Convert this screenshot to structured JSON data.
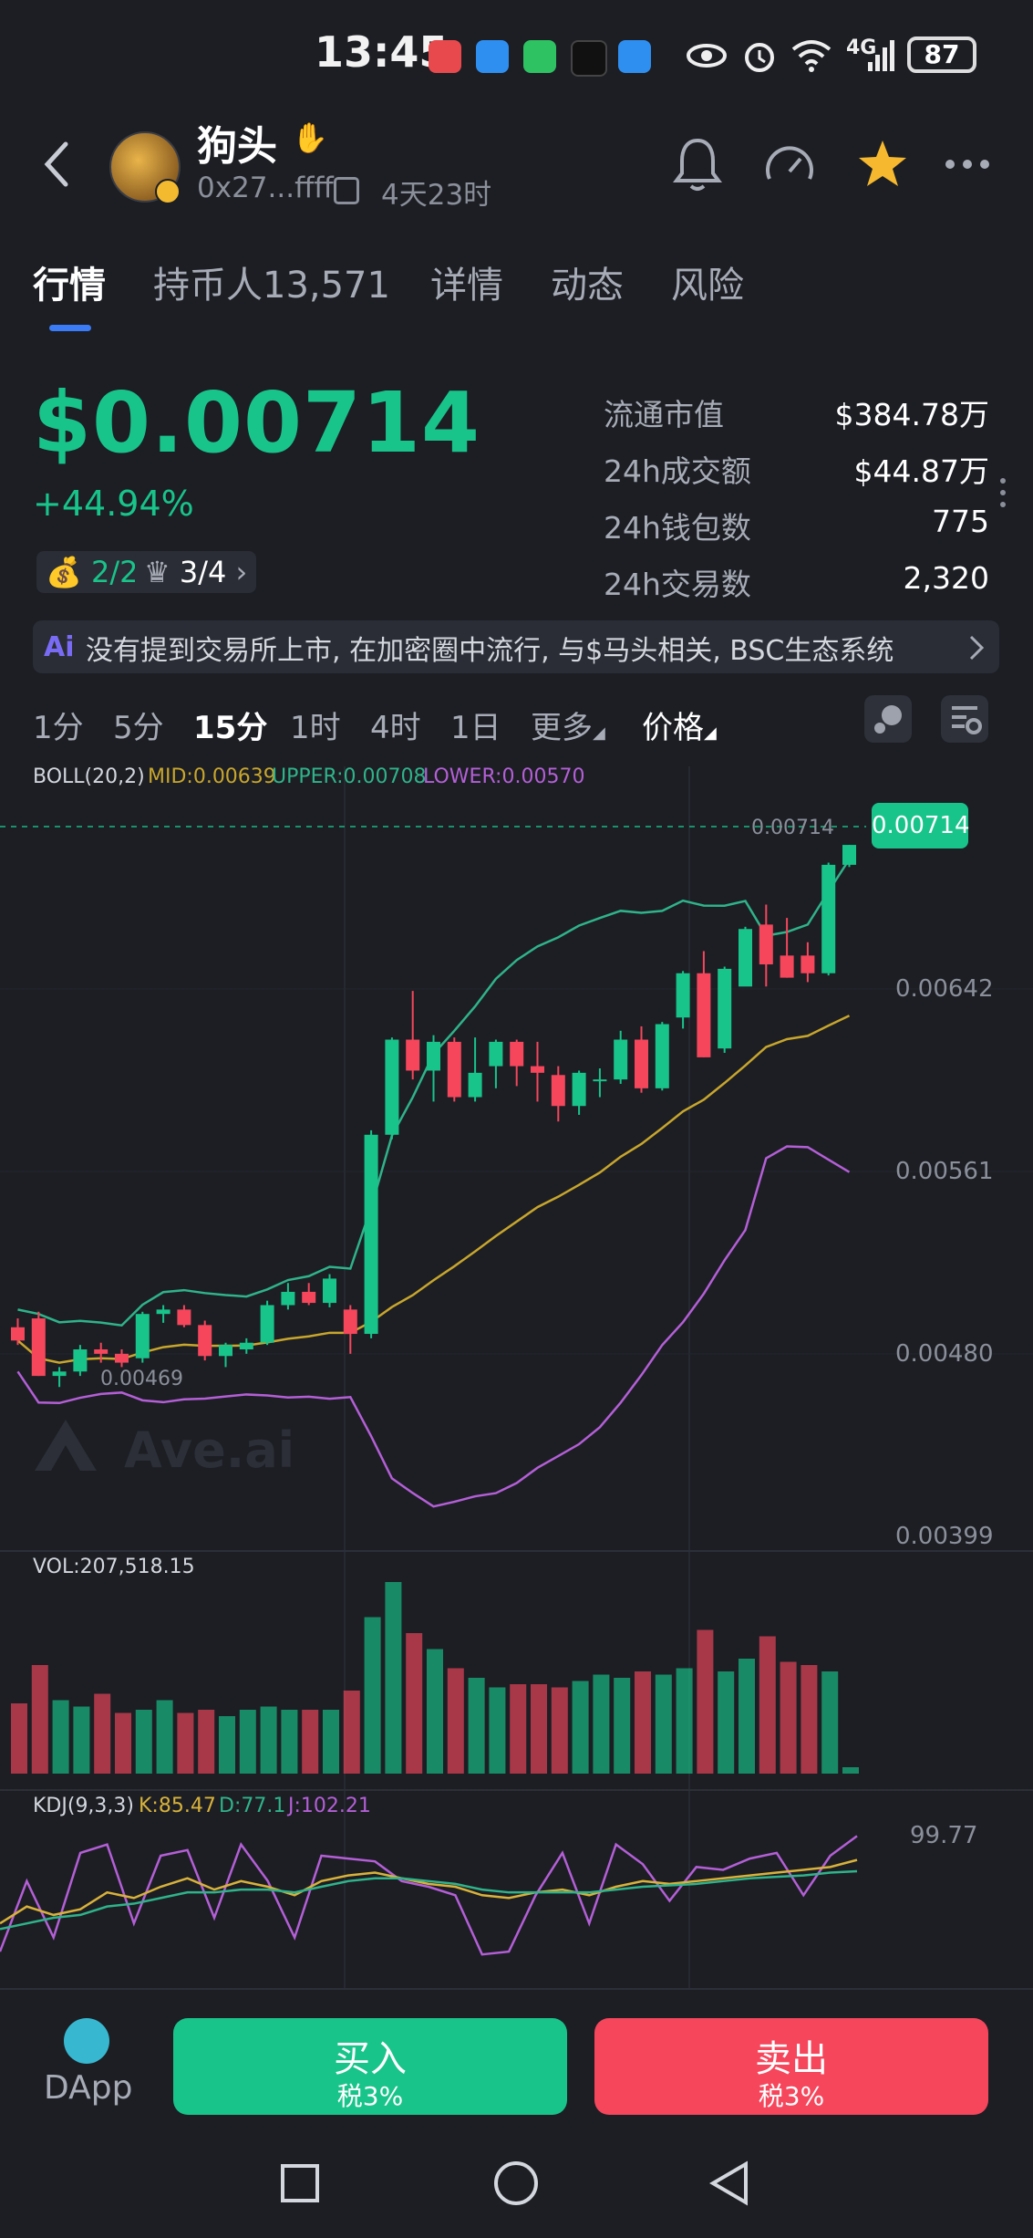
{
  "status_bar": {
    "time": "13:45",
    "battery": "87",
    "network": "4G"
  },
  "header": {
    "token_name": "狗头",
    "address": "0x27...ffff",
    "age": "4天23时"
  },
  "tabs": [
    {
      "label": "行情"
    },
    {
      "label": "持币人13,571"
    },
    {
      "label": "详情"
    },
    {
      "label": "动态"
    },
    {
      "label": "风险"
    }
  ],
  "price": {
    "value": "$0.00714",
    "change": "+44.94%",
    "holders_ratio_a": "2/2",
    "holders_ratio_b": "3/4"
  },
  "stats": [
    {
      "label": "流通市值",
      "value": "$384.78万"
    },
    {
      "label": "24h成交额",
      "value": "$44.87万"
    },
    {
      "label": "24h钱包数",
      "value": "775"
    },
    {
      "label": "24h交易数",
      "value": "2,320"
    }
  ],
  "ai_summary": {
    "badge": "Ai",
    "text": "没有提到交易所上市, 在加密圈中流行, 与$马头相关, BSC生态系统"
  },
  "timeframes": [
    {
      "label": "1分"
    },
    {
      "label": "5分"
    },
    {
      "label": "15分"
    },
    {
      "label": "1时"
    },
    {
      "label": "4时"
    },
    {
      "label": "1日"
    },
    {
      "label": "更多"
    },
    {
      "label": "价格"
    }
  ],
  "boll": {
    "name": "BOLL(20,2)",
    "mid": "MID:0.00639",
    "upper": "UPPER:0.00708",
    "lower": "LOWER:0.00570"
  },
  "price_axis": {
    "labels": [
      "0.00642",
      "0.00561",
      "0.00480",
      "0.00399"
    ],
    "last": "0.00714",
    "last_dash": "0.00714",
    "low_marker": "0.00469"
  },
  "watermark": "Ave.ai",
  "vol": {
    "label": "VOL:207,518.15"
  },
  "kdj": {
    "name": "KDJ(9,3,3)",
    "k": "K:85.47",
    "d": "D:77.1",
    "j": "J:102.21",
    "max": "99.77"
  },
  "bottom": {
    "dapp_label": "DApp",
    "buy_label": "买入",
    "buy_tax": "税3%",
    "sell_label": "卖出",
    "sell_tax": "税3%"
  },
  "colors": {
    "up": "#18c48a",
    "down": "#f5465c",
    "mid": "#c8a62c",
    "upper": "#2fb38a",
    "lower": "#b45fd6",
    "kdj_k": "#d8b23a",
    "kdj_d": "#2fb38a",
    "kdj_j": "#b45fd6"
  },
  "chart_data": {
    "type": "candlestick",
    "y_range": [
      0.00399,
      0.00733
    ],
    "candles": [
      [
        0.00496,
        0.005,
        0.00488,
        0.0049
      ],
      [
        0.005,
        0.00503,
        0.00474,
        0.00474
      ],
      [
        0.00474,
        0.00478,
        0.00469,
        0.00476
      ],
      [
        0.00476,
        0.00488,
        0.00474,
        0.00486
      ],
      [
        0.00486,
        0.00489,
        0.0048,
        0.00484
      ],
      [
        0.00484,
        0.00486,
        0.00478,
        0.0048
      ],
      [
        0.00482,
        0.00503,
        0.0048,
        0.00502
      ],
      [
        0.00502,
        0.00506,
        0.00498,
        0.00504
      ],
      [
        0.00504,
        0.00506,
        0.00496,
        0.00497
      ],
      [
        0.00497,
        0.00499,
        0.00481,
        0.00483
      ],
      [
        0.00483,
        0.00489,
        0.00478,
        0.00488
      ],
      [
        0.00486,
        0.00491,
        0.00484,
        0.00489
      ],
      [
        0.00489,
        0.00508,
        0.00488,
        0.00506
      ],
      [
        0.00506,
        0.00516,
        0.00504,
        0.00512
      ],
      [
        0.00512,
        0.00516,
        0.00506,
        0.00507
      ],
      [
        0.00507,
        0.0052,
        0.00505,
        0.00518
      ],
      [
        0.00504,
        0.00506,
        0.00484,
        0.00493
      ],
      [
        0.00493,
        0.00585,
        0.00491,
        0.00583
      ],
      [
        0.00583,
        0.00627,
        0.00581,
        0.00626
      ],
      [
        0.00626,
        0.00648,
        0.00608,
        0.00612
      ],
      [
        0.00612,
        0.00628,
        0.00598,
        0.00625
      ],
      [
        0.00625,
        0.00627,
        0.00598,
        0.006
      ],
      [
        0.006,
        0.00627,
        0.00598,
        0.00611
      ],
      [
        0.00614,
        0.00626,
        0.00604,
        0.00625
      ],
      [
        0.00625,
        0.00626,
        0.00605,
        0.00614
      ],
      [
        0.00614,
        0.00625,
        0.00598,
        0.00611
      ],
      [
        0.0061,
        0.00614,
        0.00589,
        0.00596
      ],
      [
        0.00596,
        0.00612,
        0.00592,
        0.00611
      ],
      [
        0.00608,
        0.00613,
        0.006,
        0.00608
      ],
      [
        0.00608,
        0.0063,
        0.00606,
        0.00626
      ],
      [
        0.00626,
        0.00632,
        0.00602,
        0.00604
      ],
      [
        0.00604,
        0.00634,
        0.00603,
        0.00633
      ],
      [
        0.00636,
        0.00657,
        0.00631,
        0.00656
      ],
      [
        0.00656,
        0.00666,
        0.00618,
        0.00618
      ],
      [
        0.00622,
        0.00659,
        0.0062,
        0.00658
      ],
      [
        0.0065,
        0.00677,
        0.00652,
        0.00676
      ],
      [
        0.00678,
        0.00687,
        0.0065,
        0.0066
      ],
      [
        0.00664,
        0.00681,
        0.00654,
        0.00654
      ],
      [
        0.00664,
        0.0067,
        0.00652,
        0.00656
      ],
      [
        0.00656,
        0.00706,
        0.00655,
        0.00705
      ],
      [
        0.00705,
        0.00714,
        0.00704,
        0.00714
      ]
    ],
    "volume": [
      44,
      68,
      46,
      42,
      50,
      38,
      40,
      46,
      38,
      40,
      36,
      40,
      42,
      40,
      40,
      40,
      52,
      98,
      120,
      88,
      78,
      66,
      60,
      54,
      56,
      56,
      54,
      58,
      62,
      60,
      64,
      62,
      66,
      90,
      64,
      72,
      86,
      70,
      68,
      64,
      4
    ],
    "kdj_k": [
      40,
      52,
      46,
      50,
      62,
      58,
      66,
      72,
      64,
      70,
      66,
      60,
      70,
      74,
      76,
      72,
      68,
      66,
      60,
      58,
      62,
      64,
      60,
      66,
      70,
      68,
      70,
      72,
      74,
      76,
      78,
      80,
      85
    ],
    "kdj_d": [
      36,
      40,
      44,
      46,
      52,
      54,
      58,
      62,
      62,
      64,
      64,
      62,
      66,
      70,
      72,
      72,
      70,
      68,
      64,
      62,
      62,
      62,
      62,
      64,
      66,
      67,
      68,
      70,
      72,
      73,
      74,
      76,
      77
    ],
    "kdj_j": [
      20,
      70,
      30,
      90,
      96,
      40,
      88,
      92,
      44,
      96,
      70,
      30,
      88,
      86,
      84,
      70,
      66,
      60,
      18,
      20,
      60,
      90,
      40,
      96,
      82,
      56,
      80,
      78,
      86,
      90,
      60,
      88,
      102
    ]
  }
}
